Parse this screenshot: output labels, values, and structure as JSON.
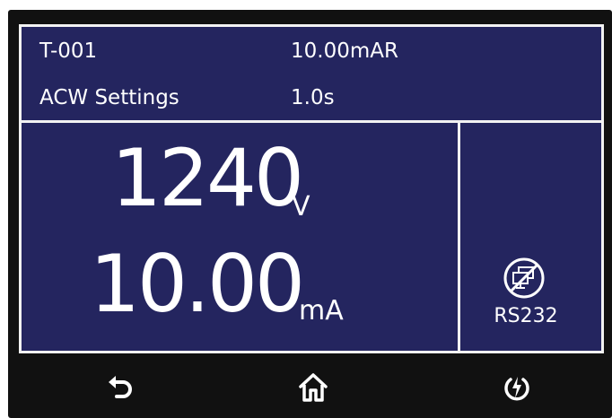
{
  "header": {
    "test_id": "T-001",
    "current_limit": "10.00mAR",
    "mode": "ACW Settings",
    "ramp_time": "1.0s"
  },
  "main": {
    "voltage_value": "1240",
    "voltage_unit": "V",
    "current_value": "10.00",
    "current_unit": "mA"
  },
  "status": {
    "interface_label": "RS232",
    "interface_icon": "rs232-disabled-icon"
  },
  "nav": {
    "back_icon": "back-arrow-icon",
    "home_icon": "home-icon",
    "power_icon": "power-icon"
  },
  "colors": {
    "screen_background": "#24255f",
    "bezel": "#111111",
    "border": "#f2f2f2",
    "text": "#ffffff"
  }
}
